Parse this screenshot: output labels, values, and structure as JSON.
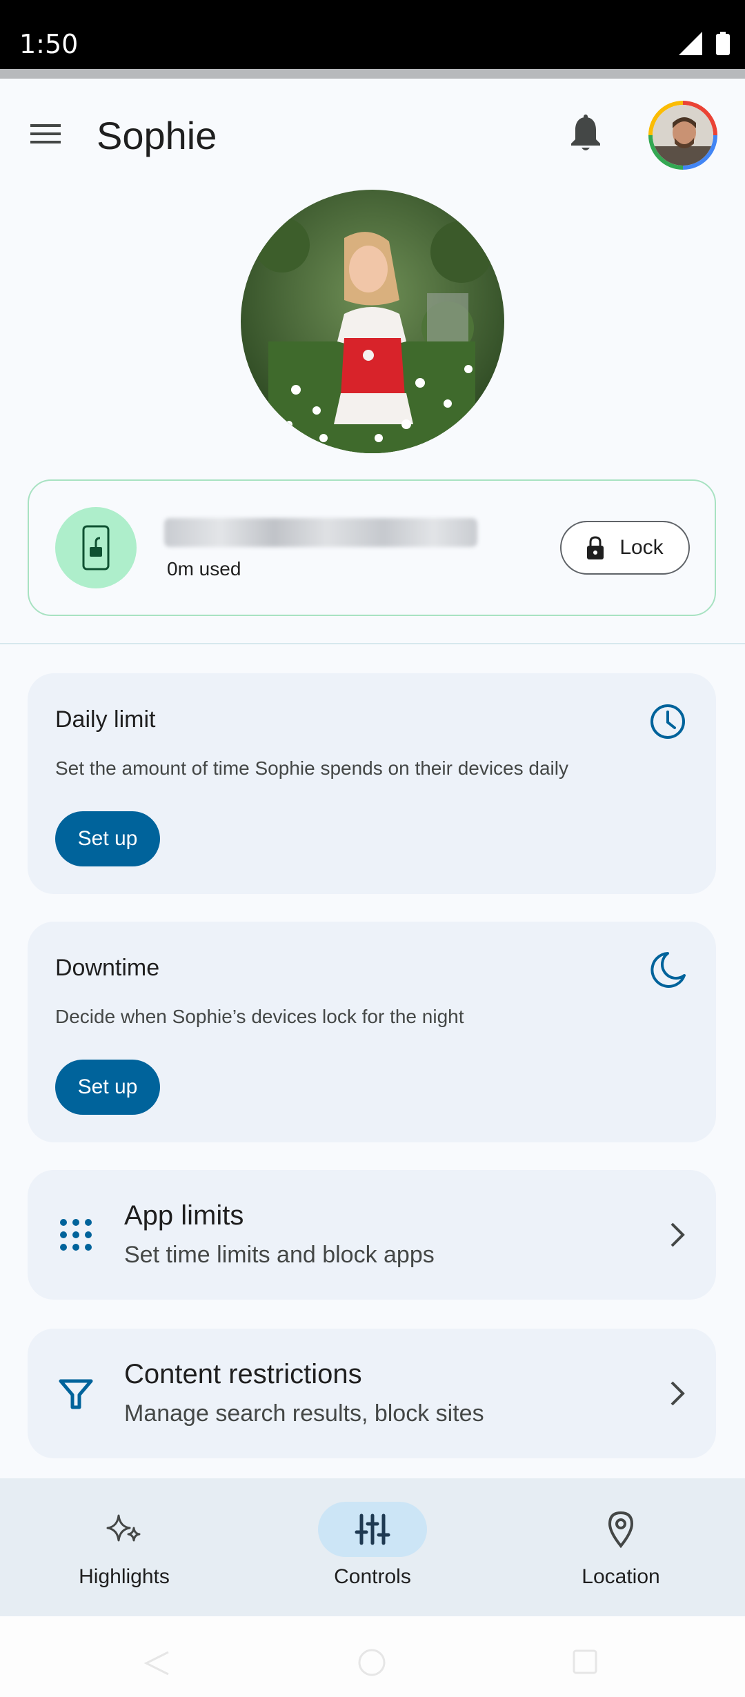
{
  "status": {
    "time": "1:50"
  },
  "header": {
    "title": "Sophie"
  },
  "device": {
    "used": "0m used",
    "lock_label": "Lock"
  },
  "cards": {
    "daily_limit": {
      "title": "Daily limit",
      "description": "Set the amount of time Sophie spends on their devices daily",
      "button": "Set up",
      "icon": "clock-icon"
    },
    "downtime": {
      "title": "Downtime",
      "description": "Decide when Sophie’s devices lock for the night",
      "button": "Set up",
      "icon": "moon-icon"
    },
    "app_limits": {
      "title": "App limits",
      "subtitle": "Set time limits and block apps",
      "icon": "apps-grid-icon"
    },
    "content": {
      "title": "Content restrictions",
      "subtitle": "Manage search results, block sites",
      "icon": "filter-icon"
    }
  },
  "bottom_nav": {
    "items": [
      {
        "label": "Highlights",
        "icon": "sparkle-icon",
        "active": false
      },
      {
        "label": "Controls",
        "icon": "sliders-icon",
        "active": true
      },
      {
        "label": "Location",
        "icon": "location-pin-icon",
        "active": false
      }
    ]
  },
  "colors": {
    "accent": "#00639b",
    "card": "#edf2f9",
    "device_green": "#aeeecb",
    "nav_active": "#cce5f6"
  }
}
